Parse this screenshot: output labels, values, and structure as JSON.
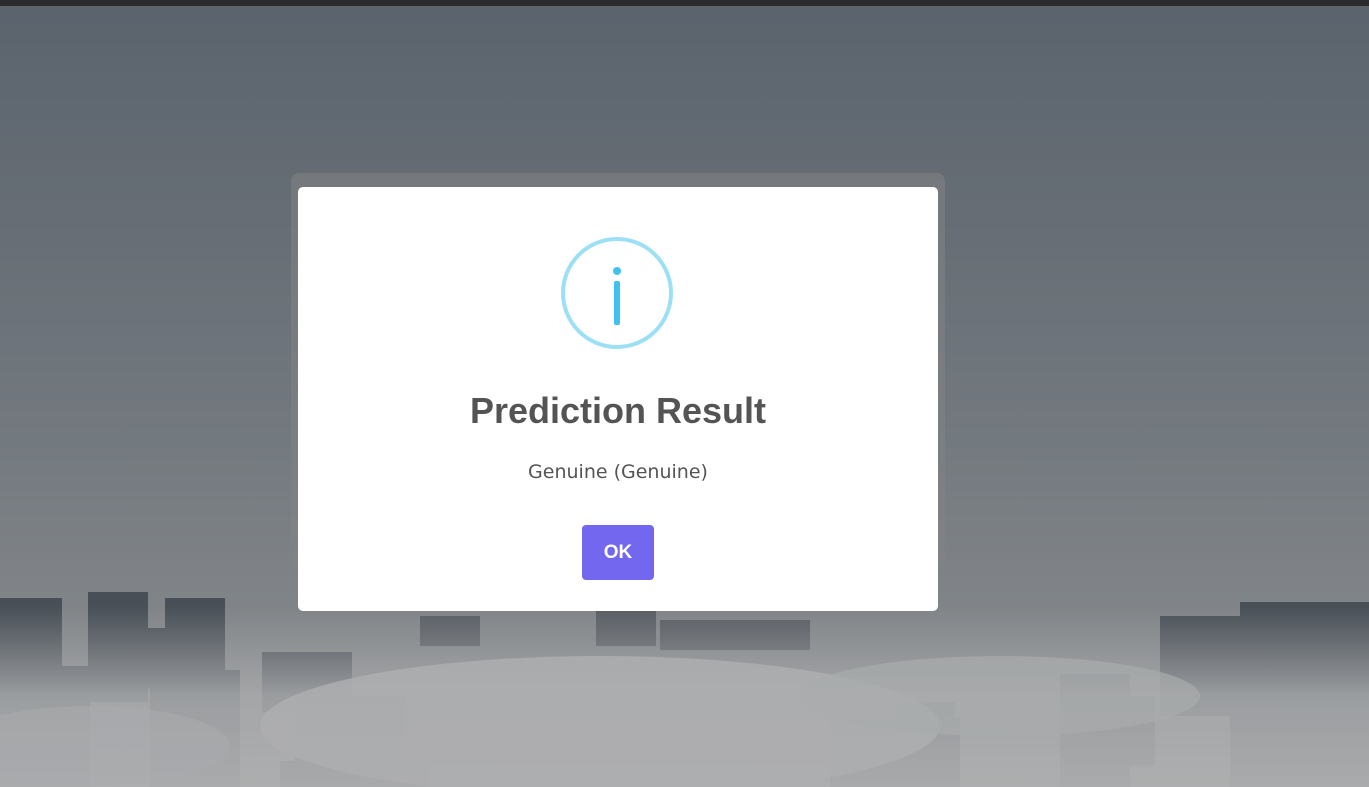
{
  "dialog": {
    "icon": "info-icon",
    "title": "Prediction Result",
    "message": "Genuine (Genuine)",
    "ok_label": "OK"
  },
  "colors": {
    "accent_button": "#7367f0",
    "info_icon": "#3fc3ee",
    "title_text": "#545454"
  }
}
